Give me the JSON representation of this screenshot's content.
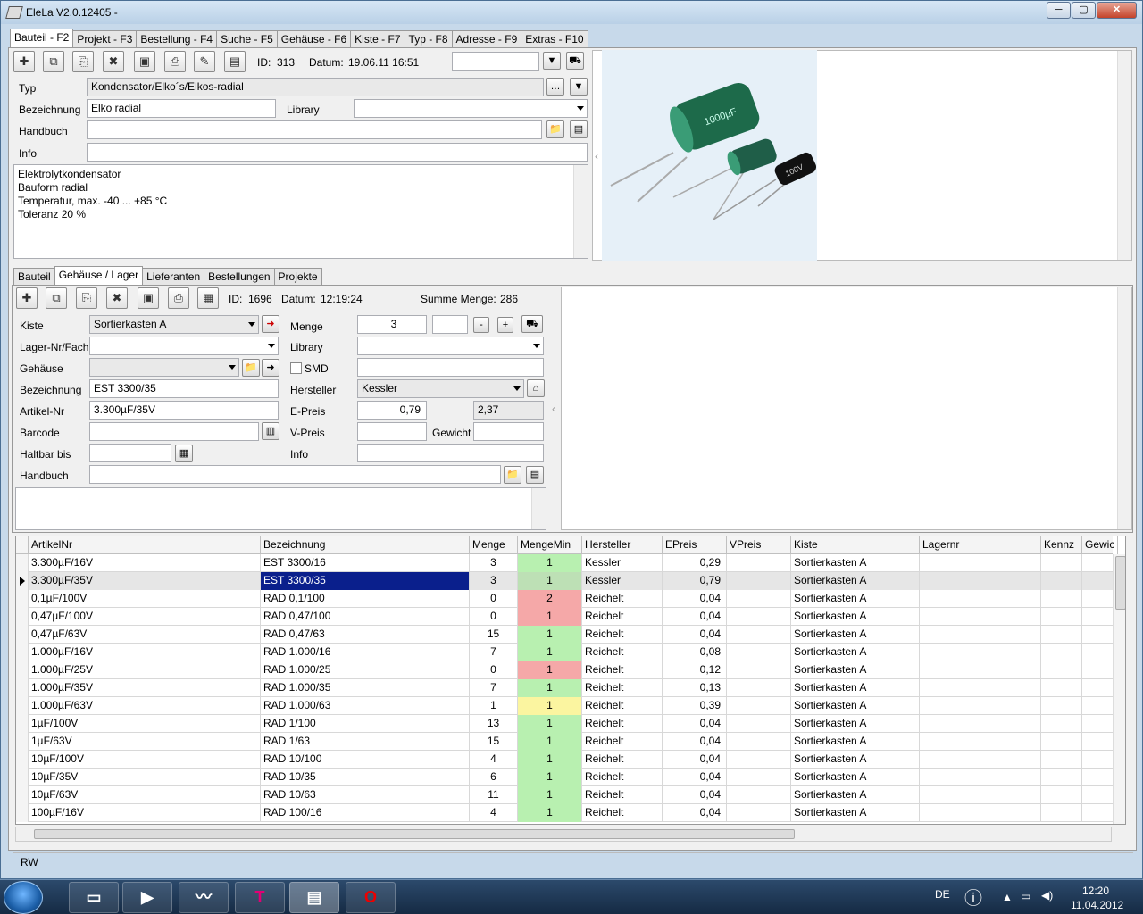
{
  "window": {
    "title": "EleLa V2.0.12405  -",
    "min": "─",
    "max": "▢",
    "close": "✕"
  },
  "main_tabs": [
    "Bauteil - F2",
    "Projekt - F3",
    "Bestellung - F4",
    "Suche - F5",
    "Gehäuse - F6",
    "Kiste - F7",
    "Typ - F8",
    "Adresse - F9",
    "Extras - F10"
  ],
  "bauteil": {
    "id_label": "ID:",
    "id": "313",
    "datum_label": "Datum:",
    "datum": "19.06.11 16:51",
    "typ_label": "Typ",
    "typ": "Kondensator/Elko´s/Elkos-radial",
    "bez_label": "Bezeichnung",
    "bez": "Elko radial",
    "library_label": "Library",
    "library": "",
    "handbuch_label": "Handbuch",
    "handbuch": "",
    "info_label": "Info",
    "info": "",
    "memo": [
      "Elektrolytkondensator",
      "Bauform radial",
      "Temperatur, max. -40 ... +85 °C",
      "Toleranz 20 %"
    ],
    "filter_value": ""
  },
  "sub_tabs": [
    "Bauteil",
    "Gehäuse / Lager",
    "Lieferanten",
    "Bestellungen",
    "Projekte"
  ],
  "lager": {
    "id_label": "ID:",
    "id": "1696",
    "datum_label": "Datum:",
    "datum": "12:19:24",
    "summe_label": "Summe Menge:",
    "summe": "286",
    "kiste_label": "Kiste",
    "kiste": "Sortierkasten A",
    "menge_label": "Menge",
    "menge": "3",
    "menge2": "",
    "lager_label": "Lager-Nr/Fach",
    "lager": "",
    "library_label": "Library",
    "library": "",
    "gehaeuse_label": "Gehäuse",
    "gehaeuse": "",
    "smd_label": "SMD",
    "bez_label": "Bezeichnung",
    "bez": "EST 3300/35",
    "hersteller_label": "Hersteller",
    "hersteller": "Kessler",
    "artikel_label": "Artikel-Nr",
    "artikel": "3.300µF/35V",
    "epreis_label": "E-Preis",
    "epreis": "0,79",
    "epreis2": "2,37",
    "barcode_label": "Barcode",
    "barcode": "",
    "vpreis_label": "V-Preis",
    "vpreis": "",
    "gewicht_label": "Gewicht",
    "gewicht": "",
    "haltbar_label": "Haltbar bis",
    "haltbar": "",
    "info_label": "Info",
    "info": "",
    "handbuch_label": "Handbuch",
    "handbuch": "",
    "minus": "-",
    "plus": "+"
  },
  "grid": {
    "columns": [
      "ArtikelNr",
      "Bezeichnung",
      "Menge",
      "MengeMin",
      "Hersteller",
      "EPreis",
      "VPreis",
      "Kiste",
      "Lagernr",
      "Kennz",
      "Gewic"
    ],
    "rows": [
      [
        "3.300µF/16V",
        "EST 3300/16",
        "3",
        "1",
        "Kessler",
        "0,29",
        "",
        "Sortierkasten A",
        "",
        "",
        ""
      ],
      [
        "3.300µF/35V",
        "EST 3300/35",
        "3",
        "1",
        "Kessler",
        "0,79",
        "",
        "Sortierkasten A",
        "",
        "",
        ""
      ],
      [
        "0,1µF/100V",
        "RAD 0,1/100",
        "0",
        "2",
        "Reichelt",
        "0,04",
        "",
        "Sortierkasten A",
        "",
        "",
        ""
      ],
      [
        "0,47µF/100V",
        "RAD 0,47/100",
        "0",
        "1",
        "Reichelt",
        "0,04",
        "",
        "Sortierkasten A",
        "",
        "",
        ""
      ],
      [
        "0,47µF/63V",
        "RAD 0,47/63",
        "15",
        "1",
        "Reichelt",
        "0,04",
        "",
        "Sortierkasten A",
        "",
        "",
        ""
      ],
      [
        "1.000µF/16V",
        "RAD 1.000/16",
        "7",
        "1",
        "Reichelt",
        "0,08",
        "",
        "Sortierkasten A",
        "",
        "",
        ""
      ],
      [
        "1.000µF/25V",
        "RAD 1.000/25",
        "0",
        "1",
        "Reichelt",
        "0,12",
        "",
        "Sortierkasten A",
        "",
        "",
        ""
      ],
      [
        "1.000µF/35V",
        "RAD 1.000/35",
        "7",
        "1",
        "Reichelt",
        "0,13",
        "",
        "Sortierkasten A",
        "",
        "",
        ""
      ],
      [
        "1.000µF/63V",
        "RAD 1.000/63",
        "1",
        "1",
        "Reichelt",
        "0,39",
        "",
        "Sortierkasten A",
        "",
        "",
        ""
      ],
      [
        "1µF/100V",
        "RAD 1/100",
        "13",
        "1",
        "Reichelt",
        "0,04",
        "",
        "Sortierkasten A",
        "",
        "",
        ""
      ],
      [
        "1µF/63V",
        "RAD 1/63",
        "15",
        "1",
        "Reichelt",
        "0,04",
        "",
        "Sortierkasten A",
        "",
        "",
        ""
      ],
      [
        "10µF/100V",
        "RAD 10/100",
        "4",
        "1",
        "Reichelt",
        "0,04",
        "",
        "Sortierkasten A",
        "",
        "",
        ""
      ],
      [
        "10µF/35V",
        "RAD 10/35",
        "6",
        "1",
        "Reichelt",
        "0,04",
        "",
        "Sortierkasten A",
        "",
        "",
        ""
      ],
      [
        "10µF/63V",
        "RAD 10/63",
        "11",
        "1",
        "Reichelt",
        "0,04",
        "",
        "Sortierkasten A",
        "",
        "",
        ""
      ],
      [
        "100µF/16V",
        "RAD 100/16",
        "4",
        "1",
        "Reichelt",
        "0,04",
        "",
        "Sortierkasten A",
        "",
        "",
        ""
      ]
    ],
    "selected_row": 1,
    "colors": {
      "ok": "#b8f0b0",
      "low": "#f5a8a8",
      "warn": "#fbf5a0",
      "selected": "#0a1f8c"
    }
  },
  "status": "RW",
  "taskbar": {
    "lang": "DE",
    "time": "12:20",
    "date": "11.04.2012",
    "icons": [
      "explorer-icon",
      "media-player-icon",
      "stock-chart-icon",
      "t-mobile-icon",
      "chip-icon",
      "opera-icon"
    ],
    "t_label": "T",
    "o_label": "O"
  },
  "image": {
    "capacitor_text_1": "1000µF",
    "capacitor_text_2": "100V"
  }
}
